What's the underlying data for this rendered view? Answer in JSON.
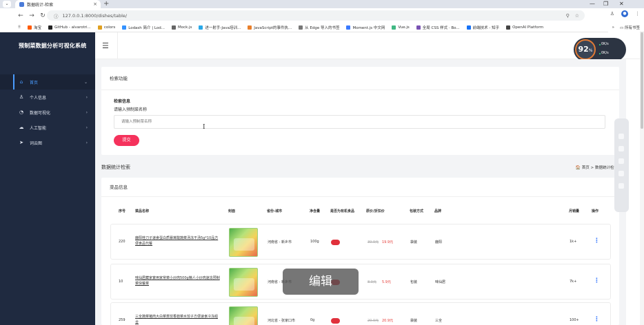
{
  "browser": {
    "tab_title": "数据统计-检索",
    "url": "127.0.0.1:8000/dishes/table/",
    "bookmarks": [
      {
        "label": "淘宝",
        "color": "#ff5a00"
      },
      {
        "label": "GitHub - alvarotri...",
        "color": "#222222"
      },
      {
        "label": "colors",
        "color": "#e0a020"
      },
      {
        "label": "Lodash 简介 | Lod...",
        "color": "#3492ff"
      },
      {
        "label": "Mock.js",
        "color": "#666666"
      },
      {
        "label": "进一射手-Java培训...",
        "color": "#2aa8e8"
      },
      {
        "label": "JavaScript的事件执...",
        "color": "#e97f2b"
      },
      {
        "label": "从 Edge 导入的书签",
        "color": "#777777"
      },
      {
        "label": "Moment.js 中文网",
        "color": "#3a7afe"
      },
      {
        "label": "Vue.js",
        "color": "#41b883"
      },
      {
        "label": "全局 CSS 样式 · Bo...",
        "color": "#7952b3"
      },
      {
        "label": "前端技术 - 知乎",
        "color": "#1772f6"
      },
      {
        "label": "OpenAI Platform",
        "color": "#444444"
      }
    ],
    "bookmarks_more": "»",
    "all_bookmarks": "所有书签"
  },
  "app": {
    "title": "预制菜数据分析可视化系统",
    "menu": [
      {
        "label": "首页",
        "icon": "home-icon"
      },
      {
        "label": "个人信息",
        "icon": "user-icon"
      },
      {
        "label": "数据可视化",
        "icon": "chart-icon"
      },
      {
        "label": "人工智能",
        "icon": "cloud-icon"
      },
      {
        "label": "词云图",
        "icon": "send-icon"
      }
    ]
  },
  "gauge": {
    "value": "92",
    "unit": "%",
    "up": "0K/s",
    "down": "0K/s"
  },
  "search": {
    "card_title": "检索功能",
    "label": "检索信息",
    "field_label": "请输入预制菜名称",
    "placeholder": "请输入预制菜名称",
    "submit": "提交"
  },
  "stats": {
    "title": "数据统计检索",
    "crumb_home": "首页",
    "crumb_sep": ">",
    "crumb_current": "数据统计检索"
  },
  "table": {
    "card_title": "菜品信息",
    "columns": [
      "序号",
      "菜品名称",
      "封面",
      "省份-城市",
      "净含量",
      "是否为有机食品",
      "原价/折扣价",
      "包装方式",
      "品牌",
      "月销量",
      "操作"
    ],
    "rows": [
      {
        "id": "220",
        "name": "鹿阳桂刀子速食蛋白质暴茸酸蔬菜汤冻干汤5g*10品方便食品代餐",
        "region": "河南省 - 新乡市",
        "weight": "100g",
        "price_old": "39.9元",
        "price_new": "19.9元",
        "packaging": "袋装",
        "brand": "鹿阳",
        "sales": "1k+"
      },
      {
        "id": "10",
        "name": "味仙居藏家宴用家常菜小炒肉500g懒人小炒肉速冻预制菜快餐菜",
        "region": "河南省 - 新乡市",
        "weight": "",
        "price_old": "8.9元",
        "price_new": "5.9元",
        "packaging": "包装",
        "brand": "味仙居",
        "sales": "7k+"
      },
      {
        "id": "259",
        "name": "三全蔬菜猪肉大白菜蒸饺香菇菜水饺子方便速食冷冻组合",
        "region": "河北省 - 张家口市",
        "weight": "0g",
        "price_old": "20.9元",
        "price_new": "20.9元",
        "packaging": "袋装",
        "brand": "三全",
        "sales": "100+"
      }
    ]
  },
  "tooltip": "编辑"
}
